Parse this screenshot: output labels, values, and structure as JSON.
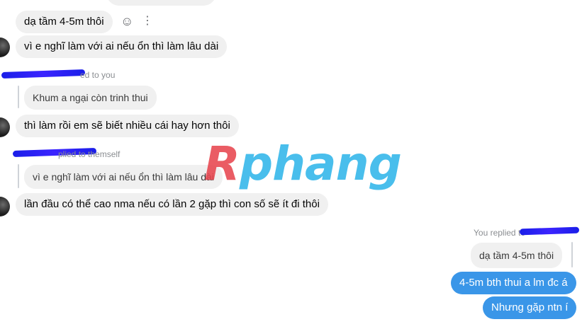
{
  "colors": {
    "incoming_bubble": "#f0f0f0",
    "outgoing_bubble": "#3a96e8",
    "meta_text": "#8a8d91",
    "redaction_scribble": "#2323f0",
    "watermark_red": "#e8464f",
    "watermark_blue": "#31b6ea"
  },
  "icons": {
    "react": "smiley-icon",
    "more": "more-vertical-icon"
  },
  "messages": {
    "m1": "dạ tầm 4-5m thôi",
    "m2": "vì e nghĩ làm với ai nếu ổn thì làm lâu dài",
    "reply1_meta": "ed to you",
    "reply1_quote": "Khum a ngại còn trinh thui",
    "m3": "thì làm rồi em sẽ biết nhiều cái hay hơn thôi",
    "reply2_meta": "plied to themself",
    "reply2_quote": "vì e nghĩ làm với ai nếu ổn thì làm lâu dài",
    "m4": "lần đầu có thể cao nma nếu có lần 2 gặp thì con số sẽ ít đi thôi",
    "reply3_meta": "You replied to",
    "reply3_quote": "dạ tầm 4-5m thôi",
    "m5": "4-5m bth thui a lm đc á",
    "m6": "Nhưng gặp ntn í"
  },
  "watermark": {
    "first": "R",
    "rest": "phang"
  }
}
